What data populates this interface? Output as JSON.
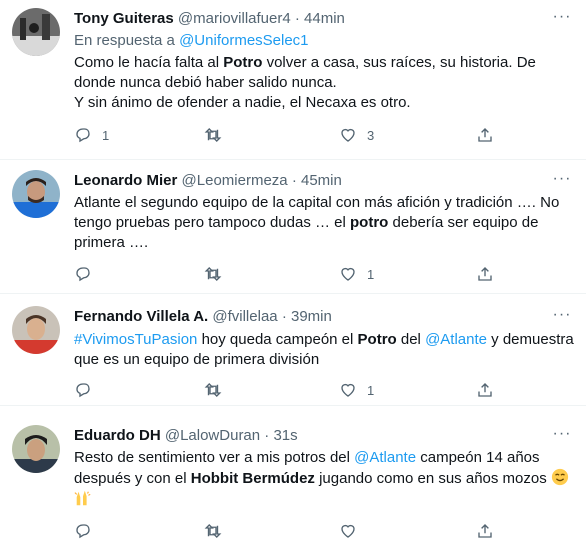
{
  "tweets": [
    {
      "name": "Tony Guiteras",
      "handle": "@mariovillafuer4",
      "time": "44min",
      "reply_prefix": "En respuesta a ",
      "reply_handle": "@UniformesSelec1",
      "text": [
        {
          "t": "Como le hacía falta al "
        },
        {
          "t": "Potro",
          "b": true
        },
        {
          "t": " volver a casa, sus raíces, su historia. De donde nunca debió haber salido nunca."
        },
        {
          "br": true
        },
        {
          "t": "Y sin ánimo de ofender a nadie, el Necaxa es otro."
        }
      ],
      "reply_count": "1",
      "retweet_count": "",
      "like_count": "3"
    },
    {
      "name": "Leonardo Mier",
      "handle": "@Leomiermeza",
      "time": "45min",
      "text": [
        {
          "t": "Atlante el segundo equipo de la capital con más afición y tradición …. No tengo pruebas pero tampoco dudas … el "
        },
        {
          "t": "potro",
          "b": true
        },
        {
          "t": " debería ser equipo de primera …."
        }
      ],
      "reply_count": "",
      "retweet_count": "",
      "like_count": "1"
    },
    {
      "name": "Fernando Villela A.",
      "handle": "@fvillelaa",
      "time": "39min",
      "text": [
        {
          "t": "#VivimosTuPasion",
          "link": true
        },
        {
          "t": " hoy queda campeón el "
        },
        {
          "t": "Potro",
          "b": true
        },
        {
          "t": " del "
        },
        {
          "t": "@Atlante",
          "link": true
        },
        {
          "t": " y demuestra que es un equipo de primera división"
        }
      ],
      "reply_count": "",
      "retweet_count": "",
      "like_count": "1"
    },
    {
      "name": "Eduardo DH",
      "handle": "@LalowDuran",
      "time": "31s",
      "text": [
        {
          "t": "Resto de sentimiento ver a mis potros del "
        },
        {
          "t": "@Atlante",
          "link": true
        },
        {
          "t": " campeón 14 años después y con el "
        },
        {
          "t": "Hobbit Bermúdez",
          "b": true
        },
        {
          "t": " jugando como en sus años mozos "
        },
        {
          "emoji": "smile"
        },
        {
          "br": true
        },
        {
          "emoji": "hands"
        }
      ],
      "reply_count": "",
      "retweet_count": "",
      "like_count": ""
    }
  ],
  "separator": "·",
  "more_label": "···",
  "colors": {
    "link": "#1d9bf0",
    "muted": "#536471",
    "text": "#0f1419"
  }
}
